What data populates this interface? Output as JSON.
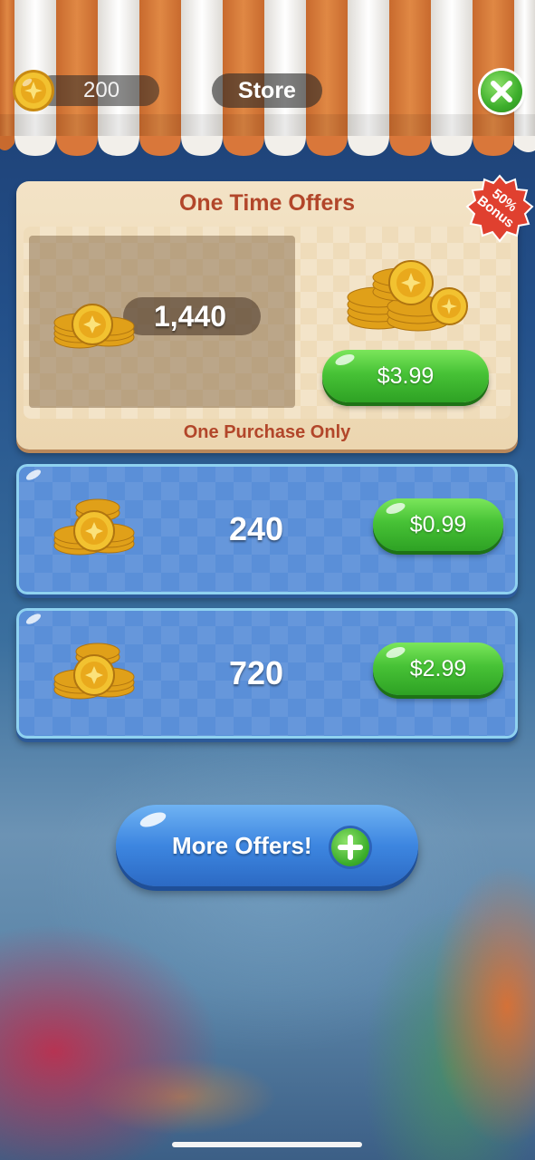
{
  "header": {
    "coin_balance": "200",
    "title": "Store"
  },
  "one_time_offer": {
    "title": "One Time Offers",
    "coin_amount": "1,440",
    "price": "$3.99",
    "footer": "One Purchase Only",
    "badge_line1": "50%",
    "badge_line2": "Bonus"
  },
  "offers": [
    {
      "coin_amount": "240",
      "price": "$0.99"
    },
    {
      "coin_amount": "720",
      "price": "$2.99"
    }
  ],
  "more_offers_label": "More Offers!",
  "colors": {
    "awning_orange": "#d9773a",
    "awning_white": "#f3f1ee",
    "offer_title_red": "#b2462a",
    "price_button_green": "#47c236",
    "card_blue": "#5a8fd8",
    "badge_red": "#e0402f"
  },
  "icons": {
    "coin": "gold-coin-icon",
    "close": "close-x-icon",
    "plus": "plus-icon",
    "coin_pile": "coin-stack-icon"
  }
}
